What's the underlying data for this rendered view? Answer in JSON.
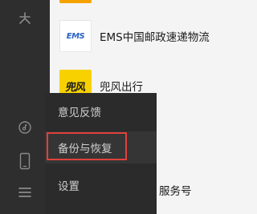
{
  "sidebar": {
    "icons": [
      "mini-programs-icon",
      "music-icon",
      "phone-icon",
      "menu-icon"
    ]
  },
  "contacts": [
    {
      "name": "EMS中国邮政速递物流",
      "logo_text": "EMS"
    },
    {
      "name": "兜风出行",
      "logo_text": "兜风"
    }
  ],
  "partial_contact": {
    "name_fragment": "服务号"
  },
  "menu": {
    "items": [
      {
        "label": "意见反馈"
      },
      {
        "label": "备份与恢复"
      },
      {
        "label": "设置"
      }
    ]
  },
  "colors": {
    "sidebar_bg": "#2e2e2e",
    "menu_bg": "#2b2b2b",
    "highlight_border": "#e0413a",
    "ems_blue": "#2a63c7",
    "brand_yellow": "#f7d100"
  }
}
